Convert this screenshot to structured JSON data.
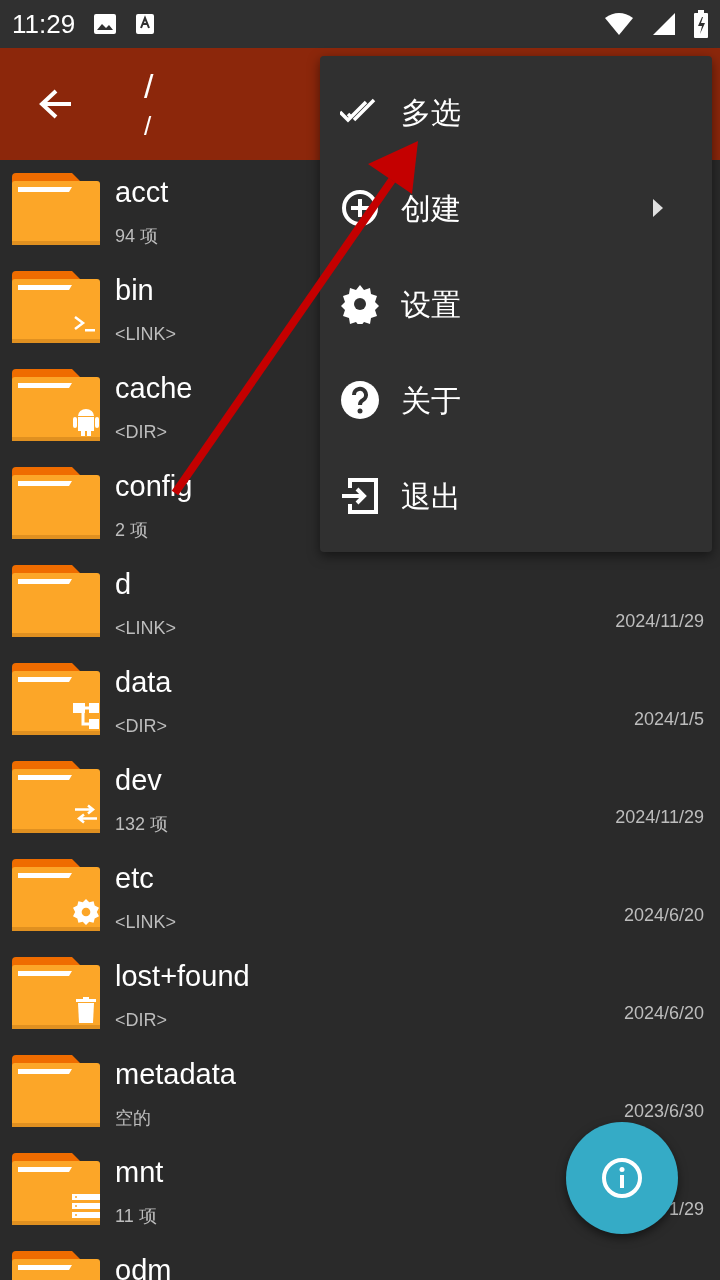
{
  "status_bar": {
    "time": "11:29"
  },
  "app_bar": {
    "title": "/",
    "subtitle": "/"
  },
  "files": [
    {
      "name": "acct",
      "detail": "94 项",
      "kind": "plain"
    },
    {
      "name": "bin",
      "detail": "<LINK>",
      "kind": "terminal"
    },
    {
      "name": "cache",
      "detail": "<DIR>",
      "kind": "android"
    },
    {
      "name": "config",
      "detail": "2 项",
      "kind": "plain"
    },
    {
      "name": "d",
      "detail": "<LINK>",
      "date": "2024/11/29",
      "kind": "plain"
    },
    {
      "name": "data",
      "detail": "<DIR>",
      "date": "2024/1/5",
      "kind": "tree"
    },
    {
      "name": "dev",
      "detail": "132 项",
      "date": "2024/11/29",
      "kind": "swap"
    },
    {
      "name": "etc",
      "detail": "<LINK>",
      "date": "2024/6/20",
      "kind": "gear"
    },
    {
      "name": "lost+found",
      "detail": "<DIR>",
      "date": "2024/6/20",
      "kind": "trash"
    },
    {
      "name": "metadata",
      "detail": "空的",
      "date": "2023/6/30",
      "kind": "plain"
    },
    {
      "name": "mnt",
      "detail": "11 项",
      "date": "1/29",
      "kind": "list"
    },
    {
      "name": "odm",
      "kind": "plain"
    }
  ],
  "menu": [
    {
      "label": "多选",
      "kind": "double-check",
      "submenu": false
    },
    {
      "label": "创建",
      "kind": "plus-circle",
      "submenu": true
    },
    {
      "label": "设置",
      "kind": "gear",
      "submenu": false
    },
    {
      "label": "关于",
      "kind": "help",
      "submenu": false
    },
    {
      "label": "退出",
      "kind": "exit",
      "submenu": false
    }
  ]
}
